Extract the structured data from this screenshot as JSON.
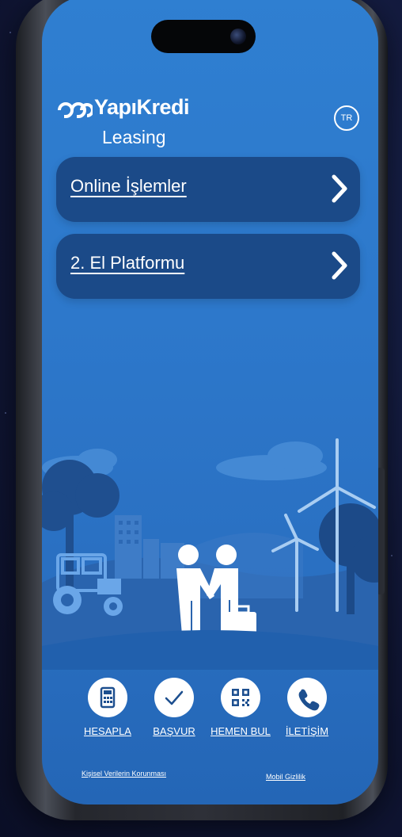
{
  "brand": {
    "name": "YapıKredi",
    "subtitle": "Leasing"
  },
  "language_badge": "TR",
  "menu": [
    {
      "label": "Online İşlemler"
    },
    {
      "label": "2. El Platformu"
    }
  ],
  "actions": [
    {
      "label": "HESAPLA",
      "icon": "calculator-icon"
    },
    {
      "label": "BAŞVUR",
      "icon": "checkmark-icon"
    },
    {
      "label": "HEMEN BUL",
      "icon": "qr-code-icon"
    },
    {
      "label": "İLETİŞİM",
      "icon": "phone-icon"
    }
  ],
  "footer": {
    "left_link": "Kişisel Verilerin Korunması",
    "right_link": "Mobil Gizlilik"
  },
  "colors": {
    "screen_bg": "#2f7fd1",
    "menu_bg": "#1b4a88",
    "text": "#ffffff"
  }
}
